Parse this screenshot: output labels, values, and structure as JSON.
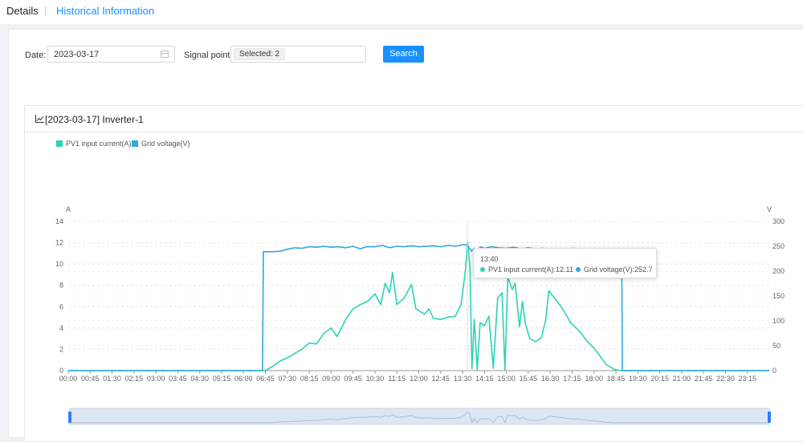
{
  "tabs": {
    "details": "Details",
    "historical": "Historical Information"
  },
  "filters": {
    "date_label": "Date",
    "date_value": "2023-03-17",
    "signal_label": "Signal point",
    "signal_value": "Selected: 2",
    "search_label": "Search"
  },
  "card": {
    "title": "[2023-03-17] Inverter-1"
  },
  "tooltip": {
    "time": "13:40",
    "current": "PV1 input current(A):12.11",
    "voltage": "Grid voltage(V):252.7"
  },
  "colors": {
    "current": "#2ed2b4",
    "voltage": "#2fa8df",
    "accent": "#1890ff"
  },
  "chart_data": {
    "type": "line",
    "legend": [
      "PV1 input current(A)",
      "Grid voltage(V)"
    ],
    "legend_position": "top-left",
    "left_axis": {
      "unit": "A",
      "range": [
        0,
        14
      ],
      "ticks": [
        0,
        2,
        4,
        6,
        8,
        10,
        12,
        14
      ]
    },
    "right_axis": {
      "unit": "V",
      "range": [
        0,
        300
      ],
      "ticks": [
        0,
        50,
        100,
        150,
        200,
        250,
        300
      ]
    },
    "x_labels": [
      "00:00",
      "00:45",
      "01:30",
      "02:15",
      "03:00",
      "03:45",
      "04:30",
      "05:15",
      "06:00",
      "06:45",
      "07:30",
      "08:15",
      "09:00",
      "09:45",
      "10:30",
      "11:15",
      "12:00",
      "12:45",
      "13:30",
      "14:15",
      "15:00",
      "15:45",
      "16:30",
      "17:15",
      "18:00",
      "18:45",
      "19:30",
      "20:15",
      "21:00",
      "21:45",
      "22:30",
      "23:15"
    ],
    "x_range_hours": [
      0,
      24
    ],
    "grid": true,
    "series": [
      {
        "name": "PV1 input current(A)",
        "axis": "left",
        "points": [
          [
            0,
            0
          ],
          [
            6.5,
            0
          ],
          [
            6.75,
            0
          ],
          [
            7.0,
            0.4
          ],
          [
            7.25,
            0.9
          ],
          [
            7.5,
            1.2
          ],
          [
            7.75,
            1.6
          ],
          [
            8.0,
            2.0
          ],
          [
            8.25,
            2.6
          ],
          [
            8.5,
            2.5
          ],
          [
            8.75,
            3.5
          ],
          [
            9.0,
            4.0
          ],
          [
            9.2,
            3.2
          ],
          [
            9.5,
            4.8
          ],
          [
            9.75,
            5.8
          ],
          [
            10.0,
            6.2
          ],
          [
            10.25,
            6.5
          ],
          [
            10.5,
            7.2
          ],
          [
            10.7,
            6.2
          ],
          [
            10.85,
            8.2
          ],
          [
            11.0,
            7.3
          ],
          [
            11.1,
            9.2
          ],
          [
            11.25,
            6.2
          ],
          [
            11.5,
            6.8
          ],
          [
            11.75,
            8.1
          ],
          [
            11.9,
            5.8
          ],
          [
            12.2,
            5.3
          ],
          [
            12.35,
            5.8
          ],
          [
            12.5,
            4.9
          ],
          [
            12.75,
            4.8
          ],
          [
            13.0,
            5.0
          ],
          [
            13.25,
            5.1
          ],
          [
            13.45,
            6.2
          ],
          [
            13.6,
            9.5
          ],
          [
            13.67,
            12.1
          ],
          [
            13.75,
            9.8
          ],
          [
            13.82,
            0.2
          ],
          [
            13.9,
            4.8
          ],
          [
            14.0,
            0.1
          ],
          [
            14.1,
            4.5
          ],
          [
            14.25,
            4.2
          ],
          [
            14.4,
            5.1
          ],
          [
            14.55,
            0.2
          ],
          [
            14.7,
            6.8
          ],
          [
            14.85,
            7.3
          ],
          [
            14.95,
            0.1
          ],
          [
            15.05,
            8.8
          ],
          [
            15.2,
            7.6
          ],
          [
            15.3,
            8.2
          ],
          [
            15.45,
            4.1
          ],
          [
            15.55,
            6.5
          ],
          [
            15.65,
            4.4
          ],
          [
            15.8,
            3.0
          ],
          [
            16.0,
            2.7
          ],
          [
            16.2,
            3.1
          ],
          [
            16.35,
            4.8
          ],
          [
            16.45,
            7.5
          ],
          [
            16.65,
            6.8
          ],
          [
            16.9,
            5.9
          ],
          [
            17.2,
            4.5
          ],
          [
            17.5,
            3.7
          ],
          [
            17.75,
            2.8
          ],
          [
            18.0,
            2.1
          ],
          [
            18.2,
            1.4
          ],
          [
            18.4,
            0.6
          ],
          [
            18.7,
            0.1
          ],
          [
            18.9,
            0
          ],
          [
            24,
            0
          ]
        ]
      },
      {
        "name": "Grid voltage(V)",
        "axis": "right",
        "points": [
          [
            0,
            0
          ],
          [
            6.65,
            0
          ],
          [
            6.68,
            239
          ],
          [
            7.0,
            239
          ],
          [
            7.25,
            240
          ],
          [
            7.5,
            244
          ],
          [
            7.75,
            247
          ],
          [
            8.0,
            246
          ],
          [
            8.25,
            249
          ],
          [
            8.5,
            248
          ],
          [
            8.75,
            250
          ],
          [
            9.0,
            248
          ],
          [
            9.25,
            249
          ],
          [
            9.5,
            247
          ],
          [
            9.75,
            250
          ],
          [
            10.0,
            245
          ],
          [
            10.2,
            249
          ],
          [
            10.5,
            249
          ],
          [
            10.75,
            252
          ],
          [
            11.0,
            247
          ],
          [
            11.25,
            250
          ],
          [
            11.5,
            249
          ],
          [
            11.75,
            251
          ],
          [
            12.0,
            249
          ],
          [
            12.25,
            250
          ],
          [
            12.5,
            251
          ],
          [
            12.75,
            249
          ],
          [
            13.0,
            252
          ],
          [
            13.25,
            250
          ],
          [
            13.5,
            253
          ],
          [
            13.67,
            252.7
          ],
          [
            13.8,
            240
          ],
          [
            13.9,
            246
          ],
          [
            14.0,
            225
          ],
          [
            14.1,
            249
          ],
          [
            14.25,
            246
          ],
          [
            14.5,
            249
          ],
          [
            14.75,
            247
          ],
          [
            15.0,
            246
          ],
          [
            15.25,
            248
          ],
          [
            15.5,
            245
          ],
          [
            15.75,
            247
          ],
          [
            16.0,
            245
          ],
          [
            16.25,
            246
          ],
          [
            16.5,
            244
          ],
          [
            16.75,
            245
          ],
          [
            17.0,
            244
          ],
          [
            17.25,
            246
          ],
          [
            17.5,
            245
          ],
          [
            17.75,
            244
          ],
          [
            18.0,
            243
          ],
          [
            18.25,
            245
          ],
          [
            18.5,
            244
          ],
          [
            18.75,
            244
          ],
          [
            18.95,
            244
          ],
          [
            18.97,
            0
          ],
          [
            24,
            0
          ]
        ]
      }
    ]
  }
}
